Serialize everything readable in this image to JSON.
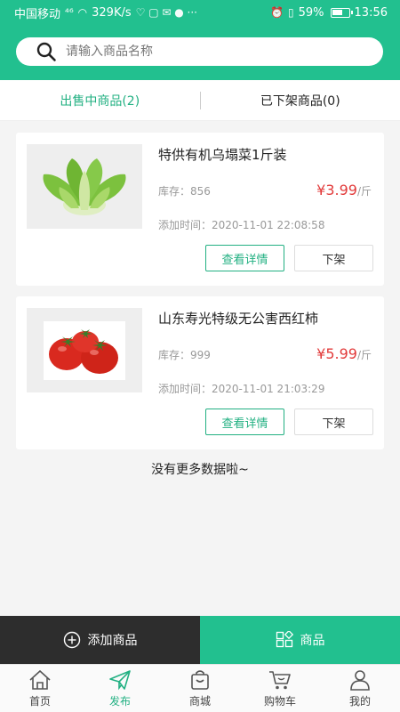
{
  "status_bar": {
    "carrier": "中国移动",
    "network": "⁴⁶",
    "speed": "329K/s",
    "battery": "59%",
    "time": "13:56"
  },
  "search": {
    "placeholder": "请输入商品名称"
  },
  "tabs": [
    {
      "label": "出售中商品(2)",
      "active": true
    },
    {
      "label": "已下架商品(0)",
      "active": false
    }
  ],
  "products": [
    {
      "title": "特供有机乌塌菜1斤装",
      "stock": "库存：856",
      "price": "¥3.99",
      "unit": "/斤",
      "added": "添加时间：2020-11-01 22:08:58",
      "detail_label": "查看详情",
      "offshelf_label": "下架",
      "image_icon": "bok-choy-image"
    },
    {
      "title": "山东寿光特级无公害西红柿",
      "stock": "库存：999",
      "price": "¥5.99",
      "unit": "/斤",
      "added": "添加时间：2020-11-01 21:03:29",
      "detail_label": "查看详情",
      "offshelf_label": "下架",
      "image_icon": "tomato-image"
    }
  ],
  "no_more": "没有更多数据啦~",
  "action_bar": {
    "add_label": "添加商品",
    "goods_label": "商品"
  },
  "bottom_nav": [
    {
      "label": "首页",
      "icon": "home-icon",
      "active": false
    },
    {
      "label": "发布",
      "icon": "send-icon",
      "active": true
    },
    {
      "label": "商城",
      "icon": "shop-bag-icon",
      "active": false
    },
    {
      "label": "购物车",
      "icon": "cart-icon",
      "active": false
    },
    {
      "label": "我的",
      "icon": "user-icon",
      "active": false
    }
  ],
  "colors": {
    "accent": "#22c08f",
    "price": "#e23b3b",
    "dark": "#2d2d2d"
  }
}
